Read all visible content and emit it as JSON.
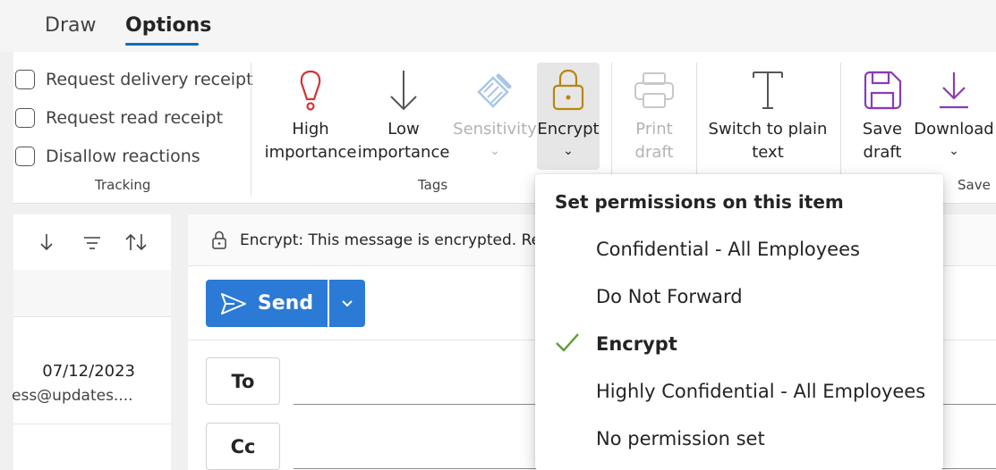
{
  "tabs": {
    "draw": "Draw",
    "options": "Options"
  },
  "tracking": {
    "items": [
      "Request delivery receipt",
      "Request read receipt",
      "Disallow reactions"
    ],
    "group_label": "Tracking"
  },
  "tags": {
    "high_line1": "High",
    "high_line2": "importance",
    "low_line1": "Low",
    "low_line2": "importance",
    "sensitivity": "Sensitivity",
    "encrypt": "Encrypt",
    "group_label": "Tags"
  },
  "print": {
    "line1": "Print",
    "line2": "draft"
  },
  "plain": {
    "line1": "Switch to plain",
    "line2": "text"
  },
  "save": {
    "save_line1": "Save",
    "save_line2": "draft",
    "download": "Download",
    "group_label": "Save"
  },
  "message_list": {
    "date": "07/12/2023",
    "from": "ess@updates...."
  },
  "compose": {
    "encrypt_notice": "Encrypt: This message is encrypted. Re",
    "send_label": "Send",
    "to_label": "To",
    "cc_label": "Cc"
  },
  "permissions_menu": {
    "title": "Set permissions on this item",
    "items": [
      "Confidential - All Employees",
      "Do Not Forward",
      "Encrypt",
      "Highly Confidential - All Employees",
      "No permission set"
    ],
    "selected": "Encrypt"
  },
  "colors": {
    "accent": "#0f6cbd",
    "send": "#2a7ad6",
    "high_importance": "#d13438",
    "encrypt_icon": "#b8860b",
    "save_icon": "#8a3ab9",
    "check": "#5b9e3a"
  },
  "icons": [
    "high-importance-icon",
    "low-importance-icon",
    "sensitivity-icon",
    "lock-icon",
    "printer-icon",
    "text-icon",
    "save-icon",
    "download-icon",
    "check-icon"
  ]
}
